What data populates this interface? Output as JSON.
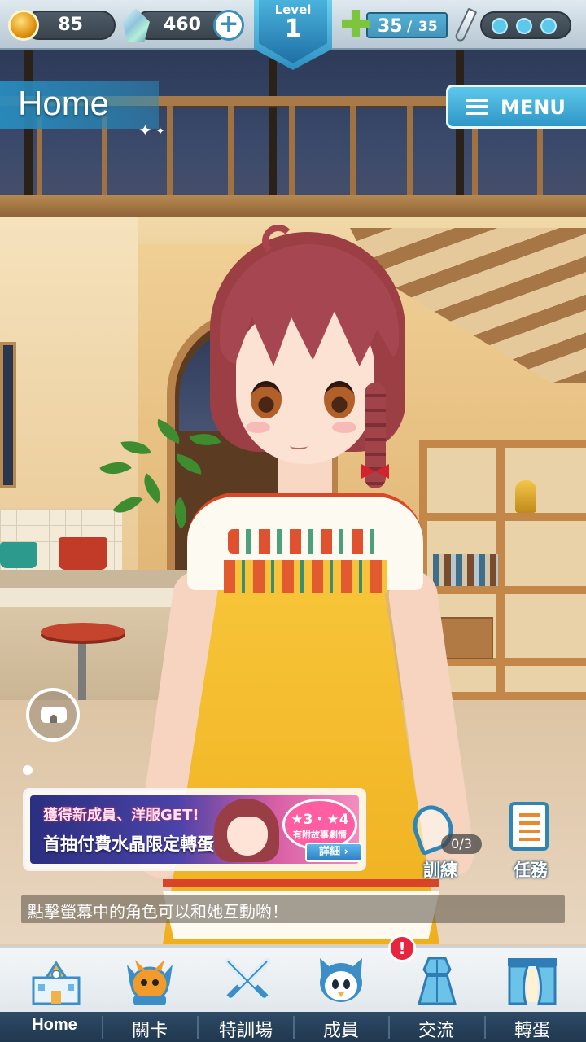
{
  "topbar": {
    "coins": "85",
    "crystals": "460",
    "level_label": "Level",
    "level_value": "1",
    "stamina_current": "35",
    "stamina_sep": "/",
    "stamina_max": "35",
    "stamina_fraction": 1.0,
    "battle_points_filled": 3
  },
  "header": {
    "title": "Home",
    "menu_label": "MENU"
  },
  "event_banner": {
    "line1": "獲得新成員、洋服GET!",
    "line2": "首抽付費水晶限定轉蛋",
    "badge_stars": "★3・★4",
    "badge_sub": "有附故事劇情",
    "detail_label": "詳細 ›"
  },
  "side_actions": {
    "training_label": "訓練",
    "training_count": "0/3",
    "tasks_label": "任務"
  },
  "hint": "點擊螢幕中的角色可以和她互動喲！",
  "nav": {
    "items": [
      {
        "label": "Home",
        "icon": "school-building-icon",
        "active": true
      },
      {
        "label": "關卡",
        "icon": "demon-mascot-icon",
        "active": false
      },
      {
        "label": "特訓場",
        "icon": "crossed-swords-icon",
        "active": false
      },
      {
        "label": "成員",
        "icon": "cat-mascot-icon",
        "active": false
      },
      {
        "label": "交流",
        "icon": "dress-icon",
        "active": false
      },
      {
        "label": "轉蛋",
        "icon": "curtain-stage-icon",
        "active": false
      }
    ],
    "alert_glyph": "!"
  },
  "colors": {
    "accent": "#2f96c6",
    "nav_strip": "#20384f",
    "alert": "#e8253f",
    "banner_pink": "#ff5ea2"
  }
}
